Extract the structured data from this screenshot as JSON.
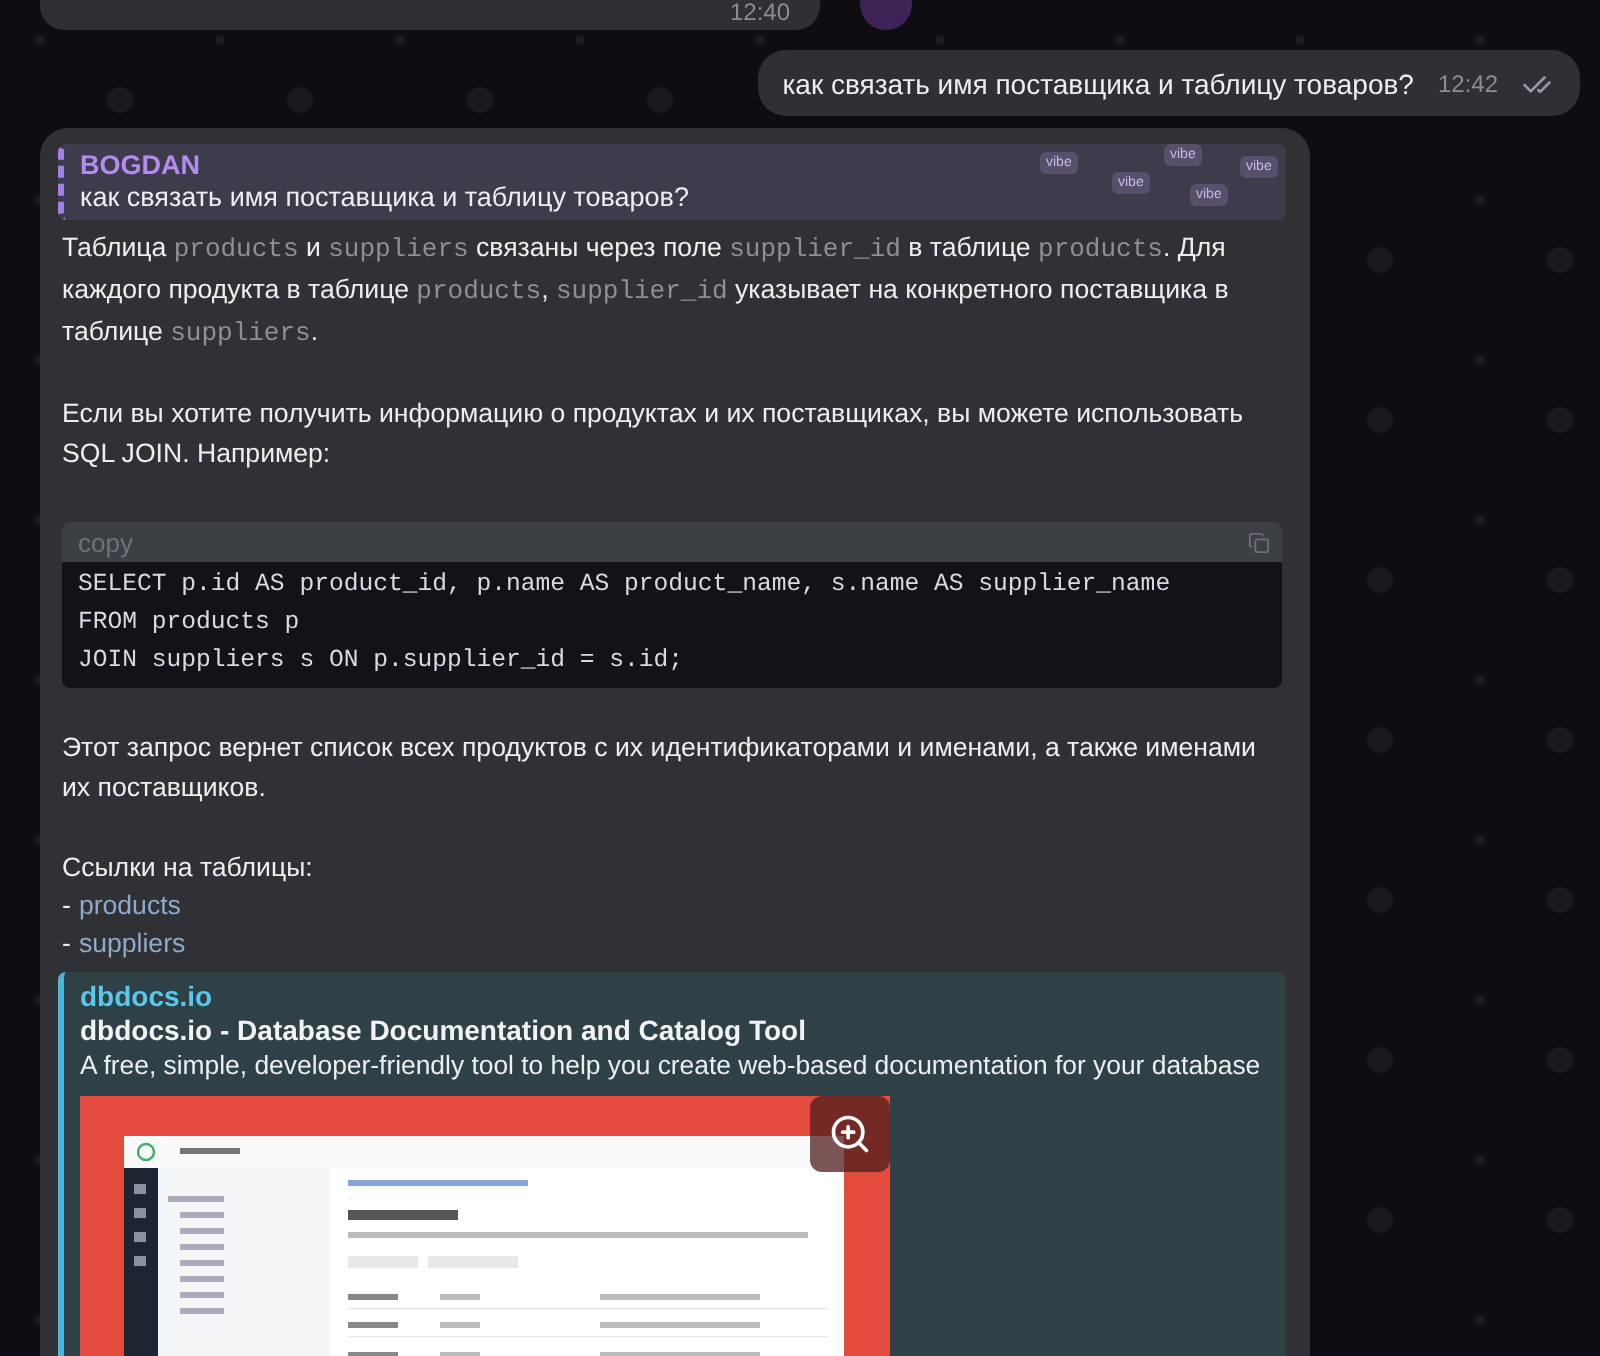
{
  "previous_message": {
    "time": "12:40"
  },
  "outgoing_message": {
    "text": "как связать имя поставщика и таблицу товаров?",
    "time": "12:42",
    "read": true
  },
  "bot_message": {
    "reply": {
      "author": "BOGDAN",
      "text": "как связать имя поставщика и таблицу товаров?",
      "stickers": [
        "vibe",
        "vibe",
        "vibe",
        "vibe",
        "vibe"
      ]
    },
    "blocks": [
      {
        "kind": "paragraph",
        "segments": [
          {
            "text": "Таблица ",
            "code": false
          },
          {
            "text": "products",
            "code": true
          },
          {
            "text": " и ",
            "code": false
          },
          {
            "text": "suppliers",
            "code": true
          },
          {
            "text": " связаны через поле ",
            "code": false
          },
          {
            "text": "supplier_id",
            "code": true
          },
          {
            "text": " в таблице ",
            "code": false
          },
          {
            "text": "products",
            "code": true
          },
          {
            "text": ". Для каждого продукта в таблице ",
            "code": false
          },
          {
            "text": "products",
            "code": true
          },
          {
            "text": ", ",
            "code": false
          },
          {
            "text": "supplier_id",
            "code": true
          },
          {
            "text": " указывает на конкретного поставщика в таблице ",
            "code": false
          },
          {
            "text": "suppliers",
            "code": true
          },
          {
            "text": ".",
            "code": false
          }
        ]
      },
      {
        "kind": "paragraph",
        "segments": [
          {
            "text": "Если вы хотите получить информацию о продуктах и их поставщиках, вы можете использовать SQL JOIN. Например:",
            "code": false
          }
        ]
      },
      {
        "kind": "code",
        "header": "copy",
        "lines": [
          "SELECT p.id AS product_id, p.name AS product_name, s.name AS supplier_name",
          "FROM products p",
          "JOIN suppliers s ON p.supplier_id = s.id;"
        ]
      },
      {
        "kind": "paragraph",
        "segments": [
          {
            "text": "Этот запрос вернет список всех продуктов с их идентификаторами и именами, а также именами их поставщиков.",
            "code": false
          }
        ]
      },
      {
        "kind": "links",
        "title": "Ссылки на таблицы:",
        "items": [
          {
            "marker": "-",
            "text": "products"
          },
          {
            "marker": "-",
            "text": "suppliers"
          }
        ]
      }
    ],
    "link_preview": {
      "site": "dbdocs.io",
      "title": "dbdocs.io - Database Documentation and Catalog Tool",
      "description": "A free, simple, developer-friendly tool to help you create web-based documentation for your database"
    }
  }
}
